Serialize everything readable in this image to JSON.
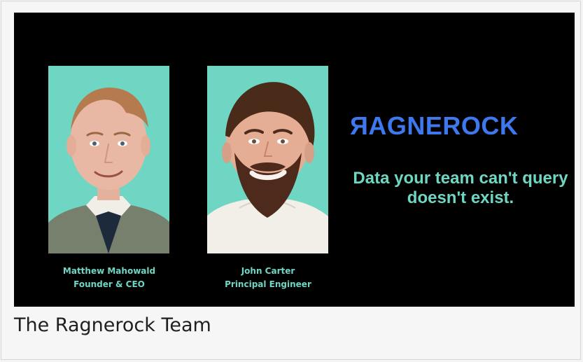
{
  "slide": {
    "brand": {
      "logo_text": "ЯAGNEROCK",
      "brand_color": "#3e78ef"
    },
    "tagline": "Data your team can't query doesn't exist.",
    "people": [
      {
        "name": "Matthew Mahowald",
        "title": "Founder & CEO"
      },
      {
        "name": "John Carter",
        "title": "Principal Engineer"
      }
    ],
    "accent_color": "#6fd6c3"
  },
  "caption": "The Ragnerock Team"
}
